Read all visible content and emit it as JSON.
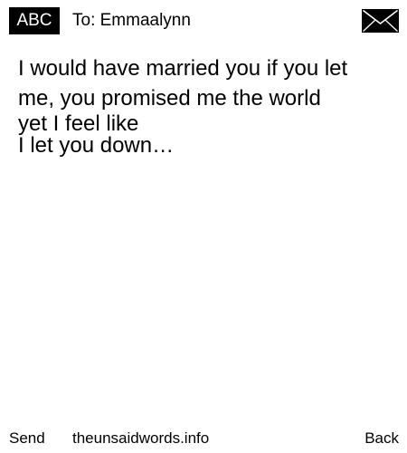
{
  "header": {
    "input_mode_label": "ABC",
    "recipient_text": "To: Emmaalynn",
    "envelope_icon": "envelope-icon"
  },
  "message": {
    "lines": [
      "I would have married you if you let",
      "me, you promised me the world",
      "yet I feel like",
      "I let you down…"
    ]
  },
  "footer": {
    "left_softkey": "Send",
    "site_label": "theunsaidwords.info",
    "right_softkey": "Back"
  },
  "colors": {
    "background": "#ffffff",
    "foreground": "#000000",
    "badge_background": "#000000",
    "badge_text": "#ffffff"
  }
}
